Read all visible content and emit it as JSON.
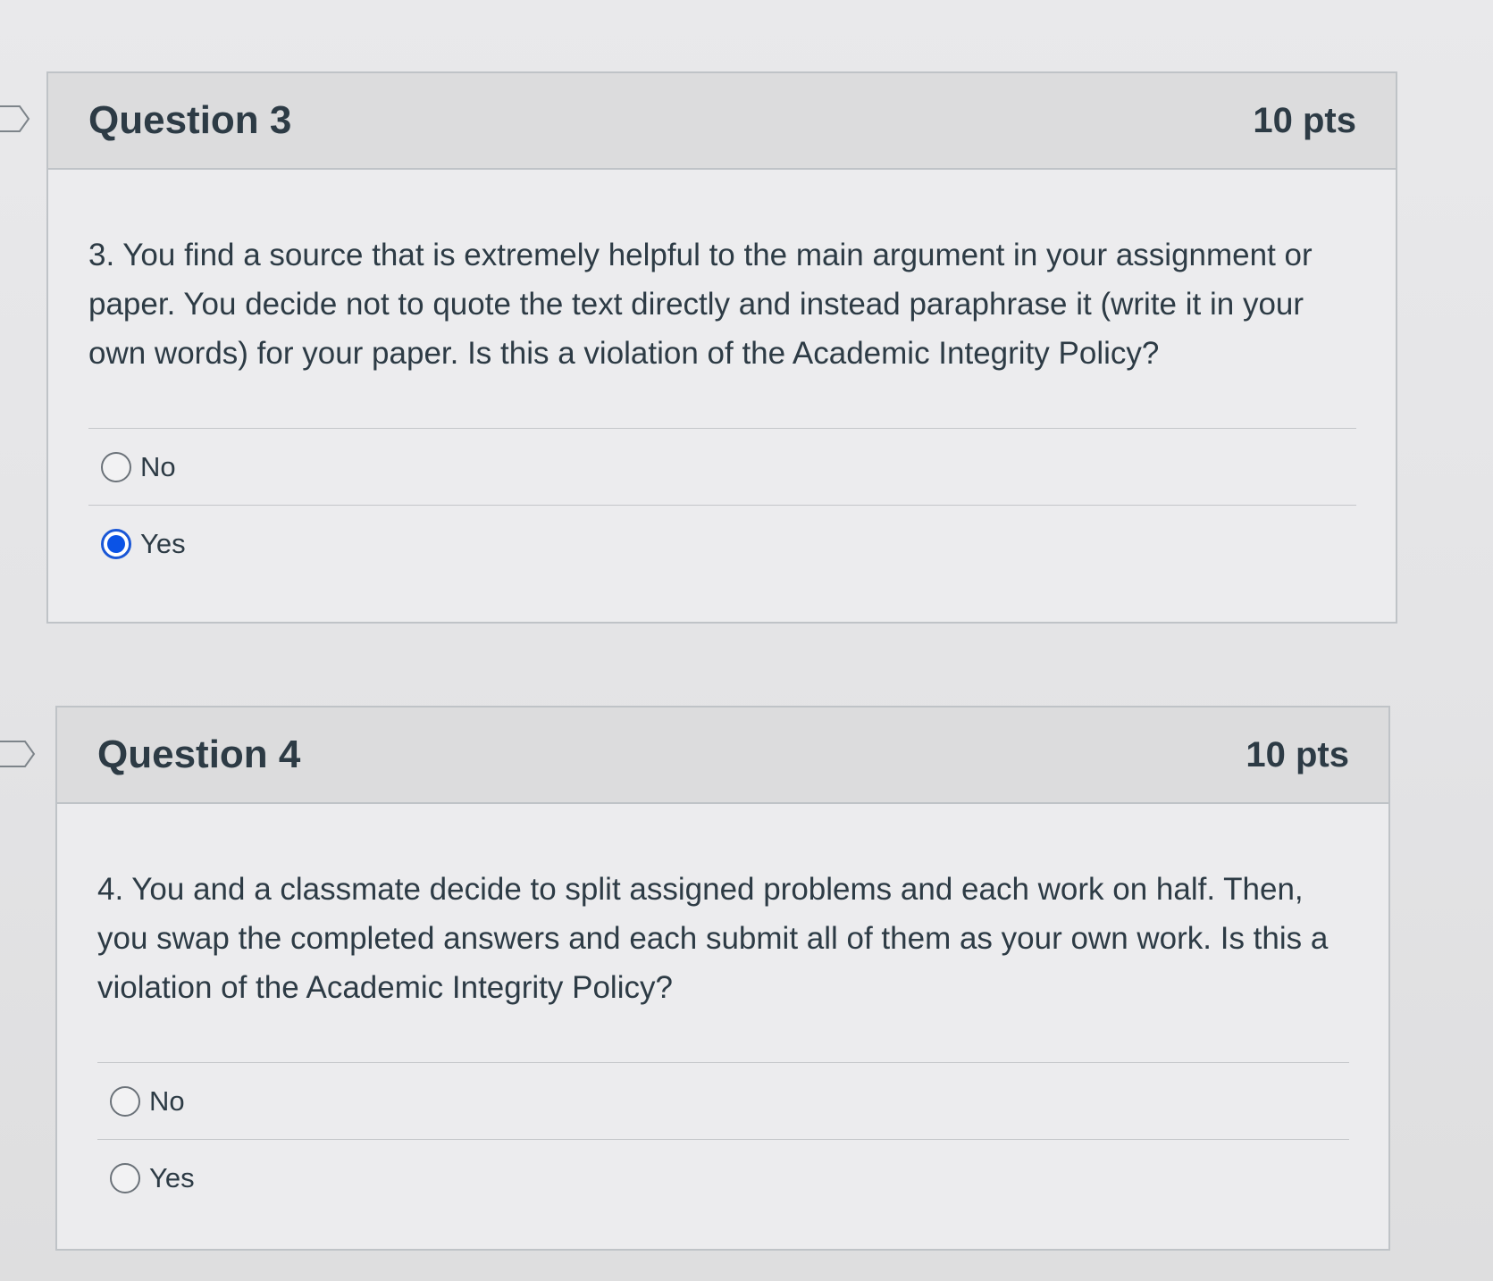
{
  "questions": [
    {
      "title": "Question 3",
      "points": "10 pts",
      "text": "3. You find a source that is extremely helpful to the main argument in your assignment or paper. You decide not to quote the text directly and instead paraphrase it (write it in your own words) for your paper. Is this a violation of the Academic Integrity Policy?",
      "answers": [
        {
          "label": "No",
          "selected": false
        },
        {
          "label": "Yes",
          "selected": true
        }
      ]
    },
    {
      "title": "Question 4",
      "points": "10 pts",
      "text": "4. You and a classmate decide to split assigned problems and each work on half. Then, you swap the completed answers and each submit all of them as your own work. Is this a violation of the Academic Integrity Policy?",
      "answers": [
        {
          "label": "No",
          "selected": false
        },
        {
          "label": "Yes",
          "selected": false
        }
      ]
    }
  ],
  "colors": {
    "selected_radio": "#0b53e6",
    "text": "#2d3b45",
    "header_bg": "#dcdcdd",
    "border": "#bfc3c7"
  }
}
